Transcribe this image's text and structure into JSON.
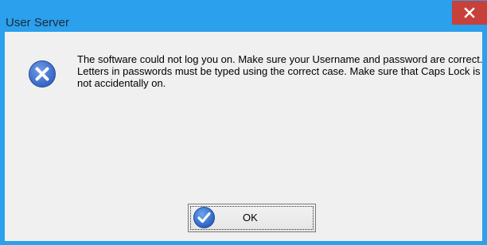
{
  "window": {
    "title": "User Server",
    "close_label": "×"
  },
  "dialog": {
    "icon": "error-icon",
    "message": "The software could not log you on. Make sure your Username and password are correct. Letters in passwords must be typed using the correct case. Make sure that Caps Lock is not accidentally on."
  },
  "buttons": {
    "ok_label": "OK",
    "ok_icon": "checkmark-icon"
  },
  "colors": {
    "titlebar": "#2ba0ec",
    "close_button": "#c7403a",
    "dialog_background": "#f0f0f0",
    "error_icon": "#3d6fcf"
  }
}
